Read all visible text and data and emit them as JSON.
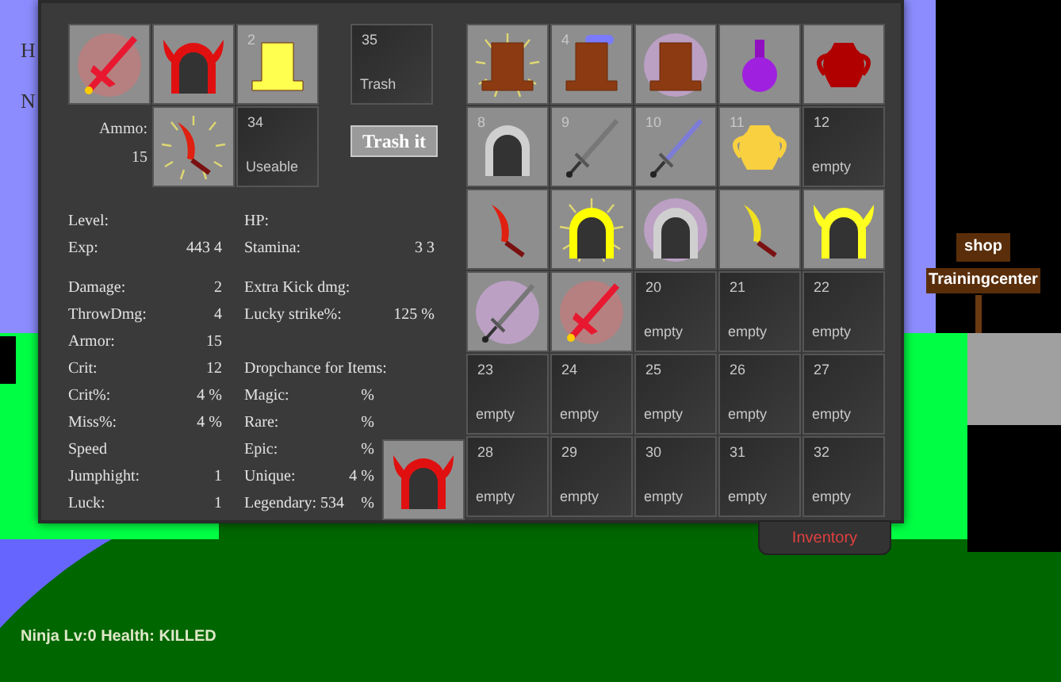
{
  "scene_letters": [
    "H",
    "N"
  ],
  "signs": [
    "shop",
    "Trainingcenter"
  ],
  "status": "Ninja Lv:0 Health: KILLED",
  "equipment": [
    {
      "item": {
        "kind": "sword-red"
      },
      "aura": {
        "kind": "red"
      }
    },
    {
      "item": {
        "kind": "horned-helmet-red"
      }
    },
    {
      "item": {
        "kind": "boot-yellow"
      },
      "number": "2"
    }
  ],
  "ammo": {
    "label": "Ammo:",
    "count": "15",
    "slot": {
      "item": {
        "kind": "dagger-red"
      },
      "aura": {
        "kind": "glow"
      }
    }
  },
  "useable": {
    "number": "34",
    "label": "Useable"
  },
  "trash": {
    "number": "35",
    "label": "Trash"
  },
  "trash_button": "Trash it",
  "stats_left": [
    [
      {
        "label": "Level:"
      },
      {
        "label": "Exp:",
        "value": "443 4"
      }
    ],
    [
      {
        "label": "Damage:",
        "value": "2"
      },
      {
        "label": "ThrowDmg:",
        "value": "4"
      },
      {
        "label": "Armor:",
        "value": "15"
      },
      {
        "label": "Crit:",
        "value": "12"
      },
      {
        "label": "Crit%:",
        "value": "4 %"
      },
      {
        "label": "Miss%:",
        "value": "4 %"
      },
      {
        "label": "Speed"
      },
      {
        "label": "Jumphight:",
        "value": "1"
      },
      {
        "label": "Luck:",
        "value": "1"
      }
    ]
  ],
  "stats_right": [
    [
      {
        "label": "HP:"
      },
      {
        "label": "Stamina:",
        "value": "3 3"
      }
    ],
    [
      {
        "label": "Extra Kick dmg:"
      },
      {
        "label": "Lucky strike%:",
        "value": "125 %"
      }
    ]
  ],
  "dropchance": {
    "title": "Dropchance for Items:",
    "rows": [
      {
        "label": "Magic:",
        "value": "%"
      },
      {
        "label": "Rare:",
        "value": "%"
      },
      {
        "label": "Epic:",
        "value": "%"
      },
      {
        "label": "Unique:",
        "value": "4 %"
      },
      {
        "label": "Legendary: 534",
        "value": "%"
      }
    ]
  },
  "held_item": {
    "item": {
      "kind": "horned-helmet-red"
    }
  },
  "slots": [
    {
      "item": {
        "kind": "boot-brown"
      },
      "aura": {
        "kind": "glow"
      }
    },
    {
      "number": "4",
      "item": {
        "kind": "boot-brown"
      },
      "aura": {
        "kind": "blue"
      }
    },
    {
      "item": {
        "kind": "boot-brown"
      },
      "aura": {
        "kind": "purple"
      }
    },
    {
      "item": {
        "kind": "potion-purple"
      }
    },
    {
      "item": {
        "kind": "pot-red"
      }
    },
    {
      "number": "8",
      "item": {
        "kind": "helmet-gray"
      }
    },
    {
      "number": "9",
      "item": {
        "kind": "sword-gray"
      }
    },
    {
      "number": "10",
      "item": {
        "kind": "sword-blue"
      }
    },
    {
      "number": "11",
      "item": {
        "kind": "pot-yellow"
      }
    },
    {
      "number": "12",
      "label": "empty"
    },
    {
      "item": {
        "kind": "dagger-red"
      }
    },
    {
      "item": {
        "kind": "helmet-yellow"
      },
      "aura": {
        "kind": "glow"
      }
    },
    {
      "item": {
        "kind": "helmet-gray"
      },
      "aura": {
        "kind": "purple"
      }
    },
    {
      "item": {
        "kind": "dagger-yellow"
      }
    },
    {
      "item": {
        "kind": "horned-helmet-yellow"
      }
    },
    {
      "item": {
        "kind": "sword-gray"
      },
      "aura": {
        "kind": "purple"
      }
    },
    {
      "item": {
        "kind": "sword-red"
      },
      "aura": {
        "kind": "red"
      }
    },
    {
      "number": "20",
      "label": "empty"
    },
    {
      "number": "21",
      "label": "empty"
    },
    {
      "number": "22",
      "label": "empty"
    },
    {
      "number": "23",
      "label": "empty"
    },
    {
      "number": "24",
      "label": "empty"
    },
    {
      "number": "25",
      "label": "empty"
    },
    {
      "number": "26",
      "label": "empty"
    },
    {
      "number": "27",
      "label": "empty"
    },
    {
      "number": "28",
      "label": "empty"
    },
    {
      "number": "29",
      "label": "empty"
    },
    {
      "number": "30",
      "label": "empty"
    },
    {
      "number": "31",
      "label": "empty"
    },
    {
      "number": "32",
      "label": "empty"
    }
  ],
  "tab": "Inventory"
}
